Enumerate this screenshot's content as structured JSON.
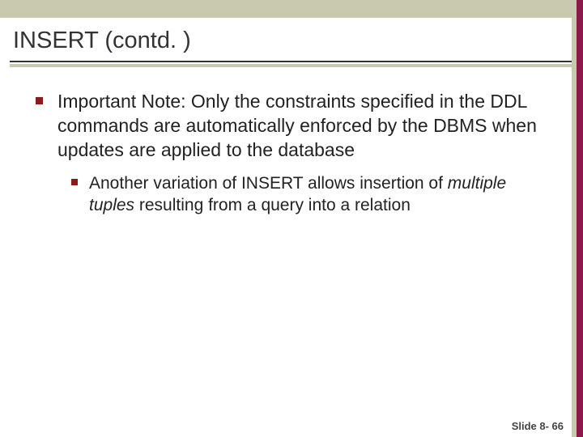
{
  "title": "INSERT (contd. )",
  "bullets": [
    {
      "text": "Important Note: Only the constraints specified in the DDL commands are automatically enforced by the DBMS when updates are applied to the database",
      "sub": [
        {
          "pre": "Another variation of INSERT allows insertion of ",
          "em": "multiple tuples",
          "post": " resulting from a query into a relation"
        }
      ]
    }
  ],
  "footer": "Slide 8- 66"
}
